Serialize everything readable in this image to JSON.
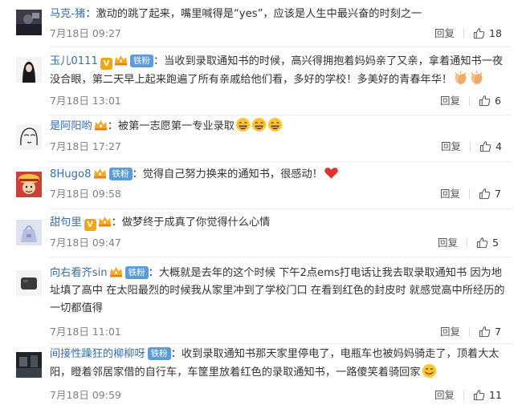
{
  "comments": [
    {
      "username": "马克-猪",
      "badges": [],
      "text": "：激动的跳了起来，嘴里喊得是“yes”，应该是人生中最兴奋的时刻之一",
      "time": "7月18日 09:27",
      "reply_label": "回复",
      "likes": "18",
      "avatar_icon": "dark-photo-avatar"
    },
    {
      "username": "玉儿0111",
      "badges": [
        "v-badge",
        "crown-badge",
        "fan-badge"
      ],
      "fan_label": "铁粉",
      "text": "：当收到录取通知书的时候，高兴得拥抱着妈妈亲了又亲，拿着通知书一夜没合眼，第二天早上起来跑遍了所有亲戚给他们看，多好的学校！多美好的青春年华！",
      "emojis": [
        "clapping-hands-emoji",
        "clapping-hands-emoji"
      ],
      "time": "7月18日 13:01",
      "reply_label": "回复",
      "likes": "6",
      "avatar_icon": "woman-portrait-avatar"
    },
    {
      "username": "是阿阳哟",
      "badges": [
        "crown-badge"
      ],
      "text": "：被第一志愿第一专业录取",
      "emojis": [
        "laughing-emoji",
        "laughing-emoji",
        "laughing-emoji"
      ],
      "time": "7月18日 17:27",
      "reply_label": "回复",
      "likes": "4",
      "avatar_icon": "sketch-face-avatar"
    },
    {
      "username": "8Hugo8",
      "badges": [
        "crown-badge",
        "fan-badge"
      ],
      "fan_label": "铁粉",
      "text": "：觉得自己努力换来的通知书，很感动！",
      "emojis": [
        "red-heart-emoji"
      ],
      "time": "7月18日 09:58",
      "reply_label": "回复",
      "likes": "7",
      "avatar_icon": "cartoon-character-avatar"
    },
    {
      "username": "甜句里",
      "badges": [
        "v-badge",
        "crown-badge"
      ],
      "text": "：做梦终于成真了你觉得什么心情",
      "time": "7月18日 09:47",
      "reply_label": "回复",
      "likes": "5",
      "avatar_icon": "bag-illustration-avatar"
    },
    {
      "username": "向右看齐sin",
      "badges": [
        "crown-badge",
        "fan-badge"
      ],
      "fan_label": "铁粉",
      "text": "：大概就是去年的这个时候 下午2点ems打电话让我去取录取通知书 因为地址填了高中 在太阳最烈的时候我从家里冲到了学校门口 在看到红色的封皮时 就感觉高中所经历的一切都值得",
      "time": "7月18日 11:01",
      "reply_label": "回复",
      "likes": "7",
      "avatar_icon": "gray-object-avatar"
    },
    {
      "username": "间接性躁狂的柳柳呀",
      "badges": [
        "fan-badge"
      ],
      "fan_label": "铁粉",
      "text": "：收到录取通知书那天家里停电了，电瓶车也被妈妈骑走了，顶着大太阳，瞪着邻居家借的自行车，车筐里放着红色的录取通知书，一路傻笑着骑回家",
      "emojis": [
        "smiling-emoji"
      ],
      "time": "7月18日 09:59",
      "reply_label": "回复",
      "likes": "11",
      "avatar_icon": "dark-scene-avatar"
    }
  ],
  "colors": {
    "username": "#3a6ea5",
    "text": "#333333",
    "meta": "#808080",
    "fan_badge": "#5b9bd8",
    "v_badge": "#f2a60c"
  },
  "icons": {
    "like": "thumbs-up-icon"
  }
}
